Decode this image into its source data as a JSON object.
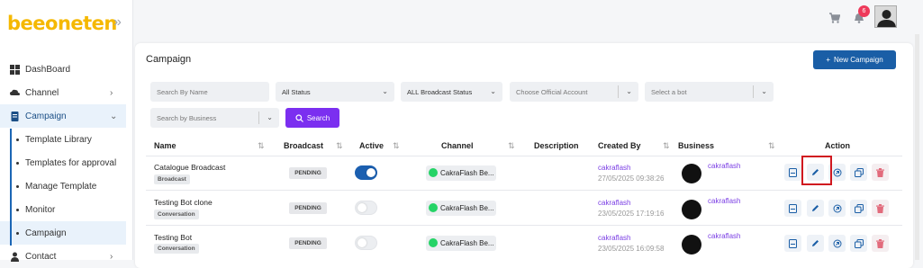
{
  "app": {
    "logo_text": "beeoneten",
    "collapse_icon": "chevron-double-right-icon"
  },
  "topbar": {
    "cart_icon": "cart-icon",
    "bell_icon": "bell-icon",
    "notification_count": "6",
    "avatar_icon": "user-avatar"
  },
  "sidebar": {
    "items": [
      {
        "label": "DashBoard",
        "icon": "grid-icon"
      },
      {
        "label": "Channel",
        "icon": "cloud-icon"
      },
      {
        "label": "Campaign",
        "icon": "document-icon"
      },
      {
        "label": "Contact",
        "icon": "person-icon"
      }
    ],
    "campaign_sub": [
      {
        "label": "Template Library"
      },
      {
        "label": "Templates for approval"
      },
      {
        "label": "Manage Template"
      },
      {
        "label": "Monitor"
      },
      {
        "label": "Campaign"
      }
    ]
  },
  "page": {
    "title": "Campaign",
    "new_button": "New Campaign"
  },
  "filters": {
    "search_name_placeholder": "Search By Name",
    "status_value": "All Status",
    "broadcast_status_value": "ALL Broadcast Status",
    "official_account_placeholder": "Choose Official Account",
    "bot_placeholder": "Select a bot",
    "business_placeholder": "Search by Business",
    "search_button": "Search"
  },
  "table": {
    "columns": [
      "Name",
      "Broadcast",
      "Active",
      "Channel",
      "Description",
      "Created By",
      "Business",
      "Action"
    ],
    "rows": [
      {
        "name": "Catalogue Broadcast",
        "type": "Broadcast",
        "broadcast": "PENDING",
        "active": true,
        "channel": "CakraFlash Be...",
        "creator": "cakraflash",
        "date": "27/05/2025 09:38:26",
        "business": "cakraflash"
      },
      {
        "name": "Testing Bot clone",
        "type": "Conversation",
        "broadcast": "PENDING",
        "active": false,
        "channel": "CakraFlash Be...",
        "creator": "cakraflash",
        "date": "23/05/2025 17:19:16",
        "business": "cakraflash"
      },
      {
        "name": "Testing Bot",
        "type": "Conversation",
        "broadcast": "PENDING",
        "active": false,
        "channel": "CakraFlash Be...",
        "creator": "cakraflash",
        "date": "23/05/2025 16:09:58",
        "business": "cakraflash"
      }
    ]
  },
  "colors": {
    "primary": "#1a5ea6",
    "accent": "#7b2ff0",
    "badge": "#ee3a5b",
    "logo": "#f5b800",
    "highlight": "#d0181f"
  }
}
